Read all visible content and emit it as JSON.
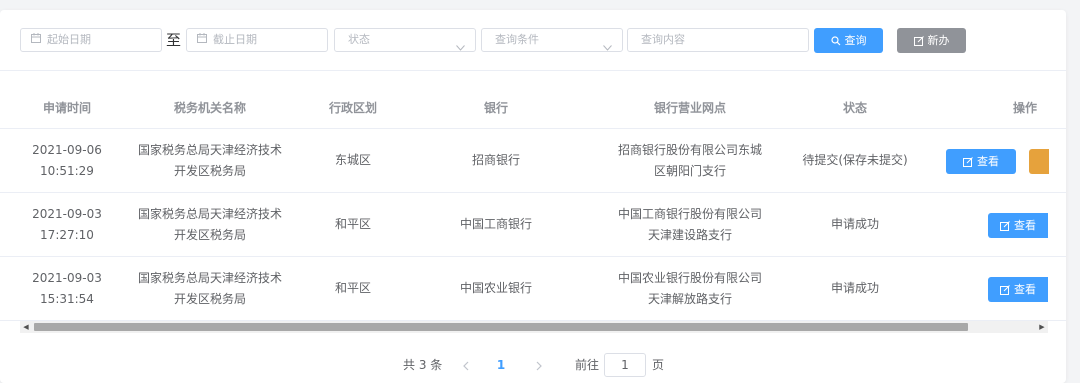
{
  "filters": {
    "start_date_placeholder": "起始日期",
    "separator": "至",
    "end_date_placeholder": "截止日期",
    "status_placeholder": "状态",
    "condition_placeholder": "查询条件",
    "content_placeholder": "查询内容",
    "search_label": "查询",
    "new_label": "新办"
  },
  "table": {
    "headers": [
      "申请时间",
      "税务机关名称",
      "行政区划",
      "银行",
      "银行营业网点",
      "状态",
      "操作"
    ],
    "rows": [
      {
        "date": "2021-09-06",
        "time": "10:51:29",
        "org_line1": "国家税务总局天津经济技术",
        "org_line2": "开发区税务局",
        "district": "东城区",
        "bank": "招商银行",
        "branch_line1": "招商银行股份有限公司东城",
        "branch_line2": "区朝阳门支行",
        "status": "待提交(保存未提交)",
        "action": "查看"
      },
      {
        "date": "2021-09-03",
        "time": "17:27:10",
        "org_line1": "国家税务总局天津经济技术",
        "org_line2": "开发区税务局",
        "district": "和平区",
        "bank": "中国工商银行",
        "branch_line1": "中国工商银行股份有限公司",
        "branch_line2": "天津建设路支行",
        "status": "申请成功",
        "action": "查看"
      },
      {
        "date": "2021-09-03",
        "time": "15:31:54",
        "org_line1": "国家税务总局天津经济技术",
        "org_line2": "开发区税务局",
        "district": "和平区",
        "bank": "中国农业银行",
        "branch_line1": "中国农业银行股份有限公司",
        "branch_line2": "天津解放路支行",
        "status": "申请成功",
        "action": "查看"
      }
    ]
  },
  "pagination": {
    "total_text": "共 3 条",
    "current_page": "1",
    "goto_label": "前往",
    "goto_value": "1",
    "page_suffix": "页"
  },
  "colors": {
    "primary": "#409eff",
    "info": "#909399",
    "warning": "#e6a23c"
  }
}
